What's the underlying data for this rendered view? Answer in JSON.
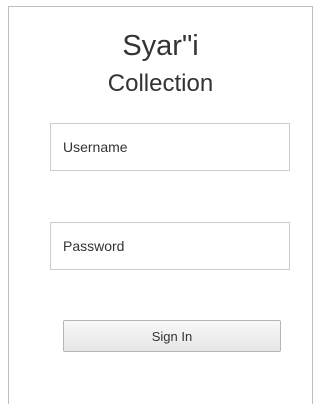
{
  "app": {
    "title_line1": "Syar\"i",
    "title_line2": "Collection"
  },
  "form": {
    "username": {
      "placeholder": "Username",
      "value": ""
    },
    "password": {
      "placeholder": "Password",
      "value": ""
    },
    "submit_label": "Sign In"
  },
  "colors": {
    "text": "#333333",
    "field_border": "#cccccc",
    "panel_border": "#bfbfbf",
    "button_top": "#f8f8f8",
    "button_bottom": "#e6e6e6"
  }
}
